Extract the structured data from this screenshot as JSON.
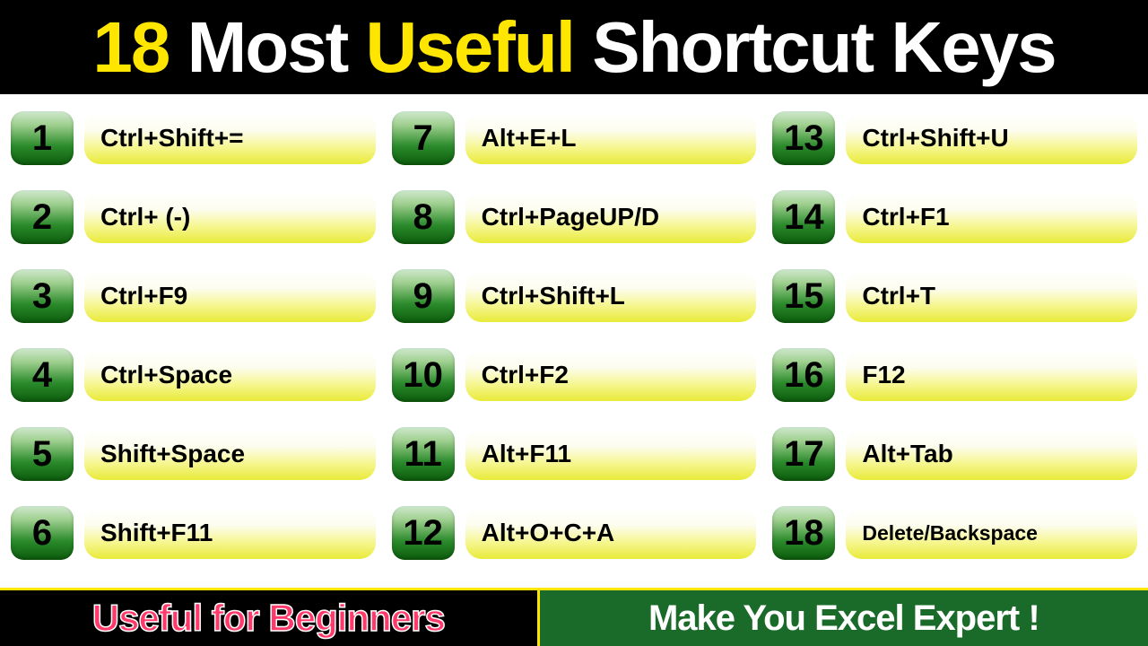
{
  "header": {
    "part1": "18",
    "part2": " Most ",
    "part3": "Useful",
    "part4": " Shortcut Keys"
  },
  "columns": [
    [
      {
        "num": "1",
        "key": "Ctrl+Shift+="
      },
      {
        "num": "2",
        "key": "Ctrl+ (-)"
      },
      {
        "num": "3",
        "key": "Ctrl+F9"
      },
      {
        "num": "4",
        "key": "Ctrl+Space"
      },
      {
        "num": "5",
        "key": "Shift+Space"
      },
      {
        "num": "6",
        "key": "Shift+F11"
      }
    ],
    [
      {
        "num": "7",
        "key": "Alt+E+L"
      },
      {
        "num": "8",
        "key": "Ctrl+PageUP/D"
      },
      {
        "num": "9",
        "key": "Ctrl+Shift+L"
      },
      {
        "num": "10",
        "key": "Ctrl+F2"
      },
      {
        "num": "11",
        "key": "Alt+F11"
      },
      {
        "num": "12",
        "key": "Alt+O+C+A"
      }
    ],
    [
      {
        "num": "13",
        "key": "Ctrl+Shift+U"
      },
      {
        "num": "14",
        "key": "Ctrl+F1"
      },
      {
        "num": "15",
        "key": "Ctrl+T"
      },
      {
        "num": "16",
        "key": "F12"
      },
      {
        "num": "17",
        "key": "Alt+Tab"
      },
      {
        "num": "18",
        "key": "Delete/Backspace",
        "small": true
      }
    ]
  ],
  "footer": {
    "left": "Useful for Beginners",
    "right": "Make You Excel Expert !"
  }
}
